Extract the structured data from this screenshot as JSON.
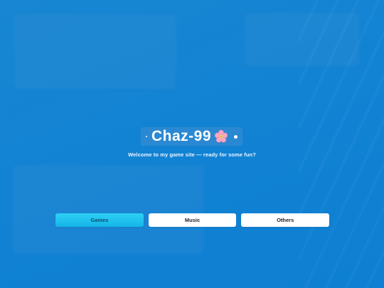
{
  "site": {
    "title": "Chaz-99",
    "title_icon": "cherry-blossom-icon",
    "welcome": "Welcome to my game site — ready for some fun?"
  },
  "nav": {
    "buttons": [
      {
        "label": "Games",
        "active": true
      },
      {
        "label": "Music",
        "active": false
      },
      {
        "label": "Others",
        "active": false
      }
    ]
  },
  "colors": {
    "background": "#1283d3",
    "active_button": "#13b5e8",
    "button": "#ffffff",
    "blossom": "#f6a9c5"
  }
}
